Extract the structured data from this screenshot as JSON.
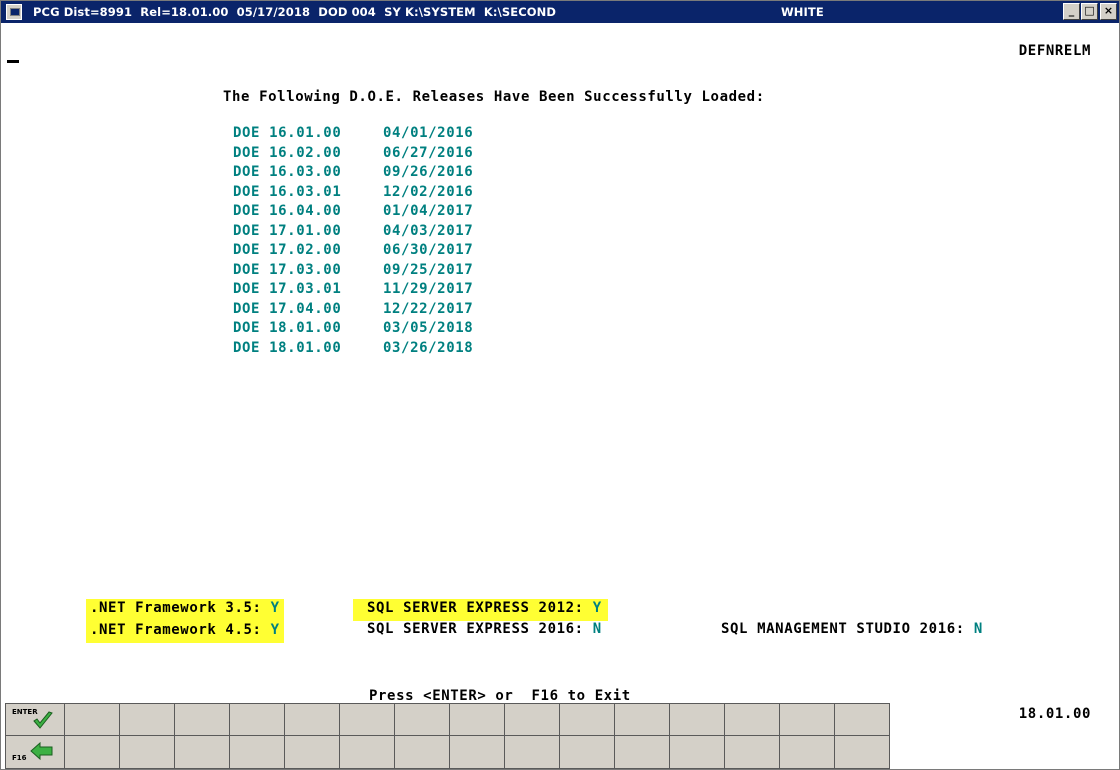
{
  "window": {
    "title": "PCG Dist=8991  Rel=18.01.00  05/17/2018  DOD 004  SY K:\\SYSTEM  K:\\SECOND",
    "user": "WHITE",
    "minimize_label": "_",
    "maximize_label": "□",
    "close_label": "×"
  },
  "screen": {
    "id": "DEFNRELM",
    "heading": "The Following D.O.E. Releases Have Been Successfully Loaded:",
    "releases": [
      {
        "name": "DOE 16.01.00",
        "date": "04/01/2016"
      },
      {
        "name": "DOE 16.02.00",
        "date": "06/27/2016"
      },
      {
        "name": "DOE 16.03.00",
        "date": "09/26/2016"
      },
      {
        "name": "DOE 16.03.01",
        "date": "12/02/2016"
      },
      {
        "name": "DOE 16.04.00",
        "date": "01/04/2017"
      },
      {
        "name": "DOE 17.01.00",
        "date": "04/03/2017"
      },
      {
        "name": "DOE 17.02.00",
        "date": "06/30/2017"
      },
      {
        "name": "DOE 17.03.00",
        "date": "09/25/2017"
      },
      {
        "name": "DOE 17.03.01",
        "date": "11/29/2017"
      },
      {
        "name": "DOE 17.04.00",
        "date": "12/22/2017"
      },
      {
        "name": "DOE 18.01.00",
        "date": "03/05/2018"
      },
      {
        "name": "DOE 18.01.00",
        "date": "03/26/2018"
      }
    ]
  },
  "status": {
    "net35": {
      "label": ".NET Framework 3.5: ",
      "value": "Y"
    },
    "net45": {
      "label": ".NET Framework 4.5: ",
      "value": "Y"
    },
    "sql2012": {
      "label": "SQL SERVER EXPRESS 2012: ",
      "value": "Y"
    },
    "sql2016": {
      "label": "SQL SERVER EXPRESS 2016: ",
      "value": "N"
    },
    "sqlms2016": {
      "label": "SQL MANAGEMENT STUDIO 2016: ",
      "value": "N"
    }
  },
  "footer": {
    "prompt": "Press <ENTER> or  F16 to Exit",
    "version": "18.01.00",
    "enter_key_label": "ENTER",
    "f16_key_label": "F16",
    "enter_icon": "green-checkmark-icon",
    "f16_icon": "green-left-arrow-icon"
  },
  "colors": {
    "title_bar": "#0a246a",
    "data_text": "#008080",
    "highlight": "#ffff33",
    "key_face": "#d4d0c8"
  }
}
